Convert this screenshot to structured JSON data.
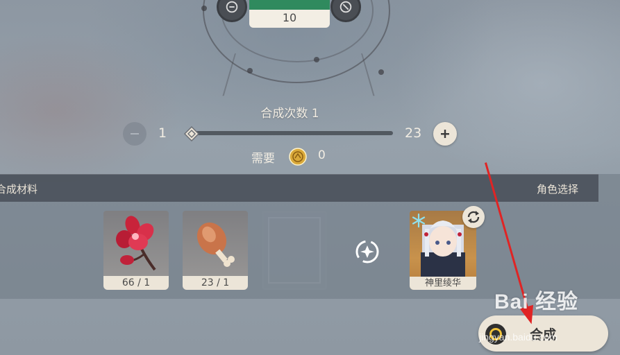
{
  "top_card": {
    "value": "10"
  },
  "craft_count": {
    "title": "合成次数 1",
    "min_label": "1",
    "max_label": "23",
    "slider_value": 1,
    "slider_max": 23
  },
  "requirement": {
    "label": "需要",
    "currency_icon": "mora-coin-icon",
    "value": "0"
  },
  "panel": {
    "materials_label": "合成材料",
    "character_label": "角色选择",
    "items": [
      {
        "icon": "red-flower-icon",
        "count": "66 / 1"
      },
      {
        "icon": "meat-drumstick-icon",
        "count": "23 / 1"
      }
    ],
    "character": {
      "name": "神里绫华",
      "element_icon": "cryo-icon"
    }
  },
  "craft_button": {
    "label": "合成"
  },
  "watermark": {
    "text": "Bai 经验",
    "url": "jingyan.baidu.com"
  },
  "colors": {
    "accent_cream": "#ece5d8",
    "card_green": "#2f8a5e",
    "arrow_red": "#e02424",
    "mora_gold": "#f0c23a"
  }
}
